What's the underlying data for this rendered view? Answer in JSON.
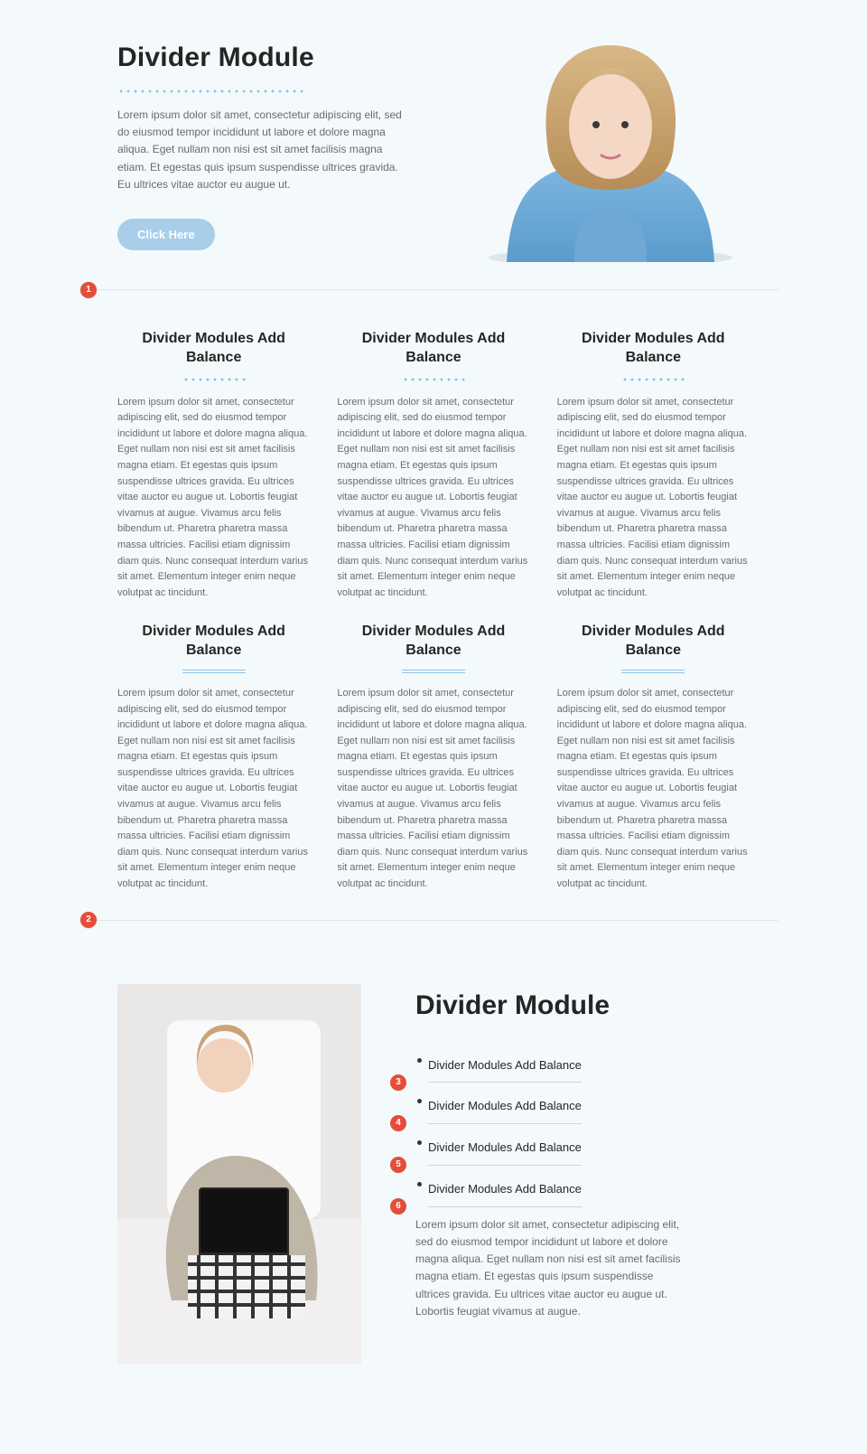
{
  "hero": {
    "title": "Divider Module",
    "body": "Lorem ipsum dolor sit amet, consectetur adipiscing elit, sed do eiusmod tempor incididunt ut labore et dolore magna aliqua. Eget nullam non nisi est sit amet facilisis magna etiam. Et egestas quis ipsum suspendisse ultrices gravida. Eu ultrices vitae auctor eu augue ut.",
    "cta": "Click Here"
  },
  "section_markers": {
    "top": "1",
    "mid": "2"
  },
  "cells": [
    {
      "title": "Divider Modules Add Balance",
      "style": "dots",
      "body": "Lorem ipsum dolor sit amet, consectetur adipiscing elit, sed do eiusmod tempor incididunt ut labore et dolore magna aliqua. Eget nullam non nisi est sit amet facilisis magna etiam. Et egestas quis ipsum suspendisse ultrices gravida. Eu ultrices vitae auctor eu augue ut. Lobortis feugiat vivamus at augue. Vivamus arcu felis bibendum ut. Pharetra pharetra massa massa ultricies. Facilisi etiam dignissim diam quis. Nunc consequat interdum varius sit amet. Elementum integer enim neque volutpat ac tincidunt."
    },
    {
      "title": "Divider Modules Add Balance",
      "style": "dots",
      "body": "Lorem ipsum dolor sit amet, consectetur adipiscing elit, sed do eiusmod tempor incididunt ut labore et dolore magna aliqua. Eget nullam non nisi est sit amet facilisis magna etiam. Et egestas quis ipsum suspendisse ultrices gravida. Eu ultrices vitae auctor eu augue ut. Lobortis feugiat vivamus at augue. Vivamus arcu felis bibendum ut. Pharetra pharetra massa massa ultricies. Facilisi etiam dignissim diam quis. Nunc consequat interdum varius sit amet. Elementum integer enim neque volutpat ac tincidunt."
    },
    {
      "title": "Divider Modules Add Balance",
      "style": "dots",
      "body": "Lorem ipsum dolor sit amet, consectetur adipiscing elit, sed do eiusmod tempor incididunt ut labore et dolore magna aliqua. Eget nullam non nisi est sit amet facilisis magna etiam. Et egestas quis ipsum suspendisse ultrices gravida. Eu ultrices vitae auctor eu augue ut. Lobortis feugiat vivamus at augue. Vivamus arcu felis bibendum ut. Pharetra pharetra massa massa ultricies. Facilisi etiam dignissim diam quis. Nunc consequat interdum varius sit amet. Elementum integer enim neque volutpat ac tincidunt."
    },
    {
      "title": "Divider Modules Add Balance",
      "style": "lines",
      "body": "Lorem ipsum dolor sit amet, consectetur adipiscing elit, sed do eiusmod tempor incididunt ut labore et dolore magna aliqua. Eget nullam non nisi est sit amet facilisis magna etiam. Et egestas quis ipsum suspendisse ultrices gravida. Eu ultrices vitae auctor eu augue ut. Lobortis feugiat vivamus at augue. Vivamus arcu felis bibendum ut. Pharetra pharetra massa massa ultricies. Facilisi etiam dignissim diam quis. Nunc consequat interdum varius sit amet. Elementum integer enim neque volutpat ac tincidunt."
    },
    {
      "title": "Divider Modules Add Balance",
      "style": "lines",
      "body": "Lorem ipsum dolor sit amet, consectetur adipiscing elit, sed do eiusmod tempor incididunt ut labore et dolore magna aliqua. Eget nullam non nisi est sit amet facilisis magna etiam. Et egestas quis ipsum suspendisse ultrices gravida. Eu ultrices vitae auctor eu augue ut. Lobortis feugiat vivamus at augue. Vivamus arcu felis bibendum ut. Pharetra pharetra massa massa ultricies. Facilisi etiam dignissim diam quis. Nunc consequat interdum varius sit amet. Elementum integer enim neque volutpat ac tincidunt."
    },
    {
      "title": "Divider Modules Add Balance",
      "style": "lines",
      "body": "Lorem ipsum dolor sit amet, consectetur adipiscing elit, sed do eiusmod tempor incididunt ut labore et dolore magna aliqua. Eget nullam non nisi est sit amet facilisis magna etiam. Et egestas quis ipsum suspendisse ultrices gravida. Eu ultrices vitae auctor eu augue ut. Lobortis feugiat vivamus at augue. Vivamus arcu felis bibendum ut. Pharetra pharetra massa massa ultricies. Facilisi etiam dignissim diam quis. Nunc consequat interdum varius sit amet. Elementum integer enim neque volutpat ac tincidunt."
    }
  ],
  "lower": {
    "title": "Divider Module",
    "items": [
      {
        "marker": "3",
        "label": "Divider Modules Add Balance"
      },
      {
        "marker": "4",
        "label": "Divider Modules Add Balance"
      },
      {
        "marker": "5",
        "label": "Divider Modules Add Balance"
      },
      {
        "marker": "6",
        "label": "Divider Modules Add Balance"
      }
    ],
    "body": "Lorem ipsum dolor sit amet, consectetur adipiscing elit, sed do eiusmod tempor incididunt ut labore et dolore magna aliqua. Eget nullam non nisi est sit amet facilisis magna etiam. Et egestas quis ipsum suspendisse ultrices gravida. Eu ultrices vitae auctor eu augue ut. Lobortis feugiat vivamus at augue."
  }
}
